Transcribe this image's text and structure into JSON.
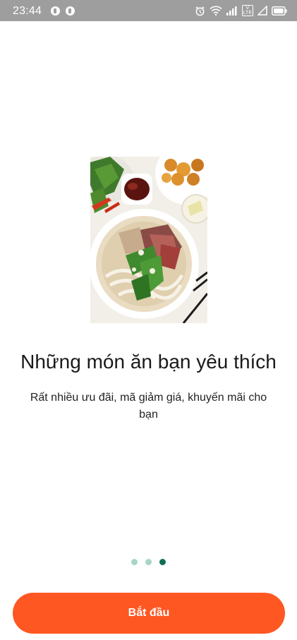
{
  "status_bar": {
    "time": "23:44",
    "icons": [
      "app-notification-icon",
      "app-notification-icon",
      "alarm-icon",
      "wifi-icon",
      "signal-icon",
      "volte-icon",
      "signal-empty-icon",
      "battery-icon"
    ],
    "volte_label_top": "V",
    "volte_label_bottom": "LTE"
  },
  "onboarding": {
    "image": "pho-bowl-food-photo",
    "title": "Những món ăn bạn yêu thích",
    "subtitle": "Rất nhiều ưu đãi, mã giảm giá, khuyến mãi cho bạn",
    "pager": {
      "total": 3,
      "active_index": 2
    },
    "start_label": "Bắt đầu"
  },
  "colors": {
    "status_bar": "#9e9e9e",
    "accent_button": "#ff5722",
    "dot_active": "#0e6e53",
    "dot_inactive": "#a8d5c9"
  }
}
